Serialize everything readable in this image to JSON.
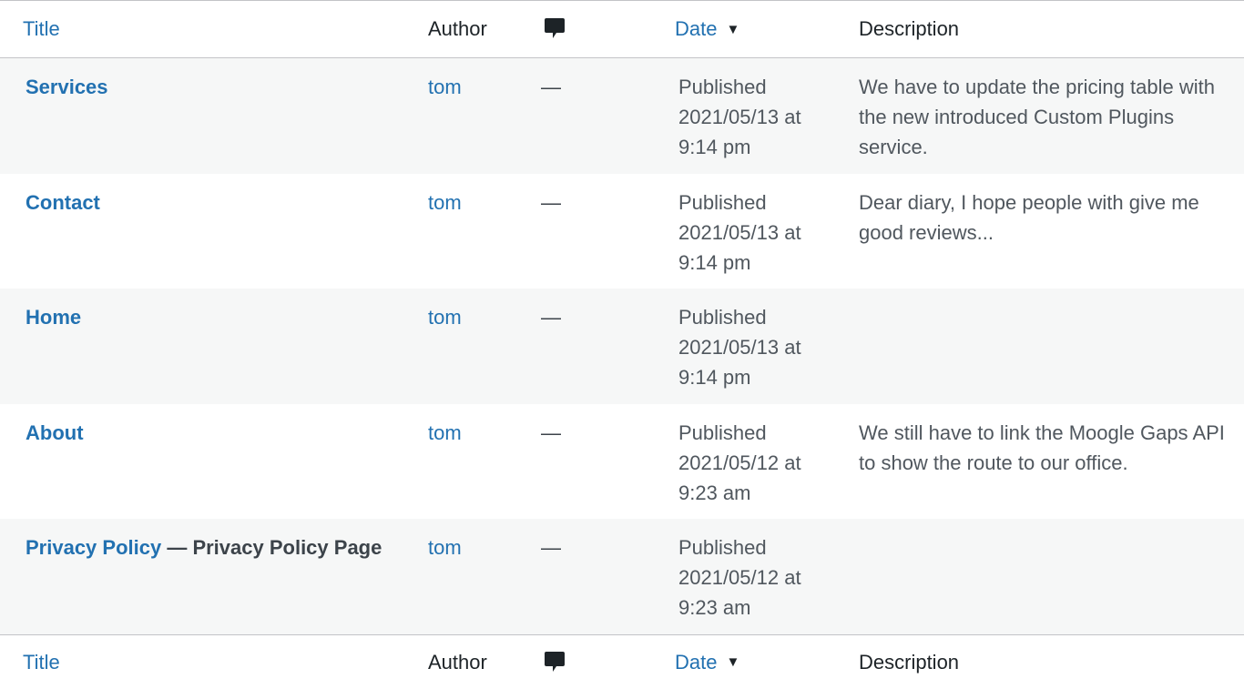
{
  "columns": {
    "title": "Title",
    "author": "Author",
    "date": "Date",
    "date_sort_indicator": "▼",
    "description": "Description",
    "comments_icon": "comment-bubble-icon"
  },
  "rows": [
    {
      "title": "Services",
      "state": "",
      "author": "tom",
      "comments": "—",
      "date_status": "Published",
      "date_value": "2021/05/13 at",
      "date_time": "9:14 pm",
      "description": "We have to update the pricing table with the new introduced Custom Plugins service."
    },
    {
      "title": "Contact",
      "state": "",
      "author": "tom",
      "comments": "—",
      "date_status": "Published",
      "date_value": "2021/05/13 at",
      "date_time": "9:14 pm",
      "description": "Dear diary, I hope people with give me good reviews..."
    },
    {
      "title": "Home",
      "state": "",
      "author": "tom",
      "comments": "—",
      "date_status": "Published",
      "date_value": "2021/05/13 at",
      "date_time": "9:14 pm",
      "description": ""
    },
    {
      "title": "About",
      "state": "",
      "author": "tom",
      "comments": "—",
      "date_status": "Published",
      "date_value": "2021/05/12 at",
      "date_time": "9:23 am",
      "description": "We still have to link the Moogle Gaps API to show the route to our office."
    },
    {
      "title": "Privacy Policy",
      "state": " — Privacy Policy Page",
      "author": "tom",
      "comments": "—",
      "date_status": "Published",
      "date_value": "2021/05/12 at",
      "date_time": "9:23 am",
      "description": ""
    }
  ]
}
